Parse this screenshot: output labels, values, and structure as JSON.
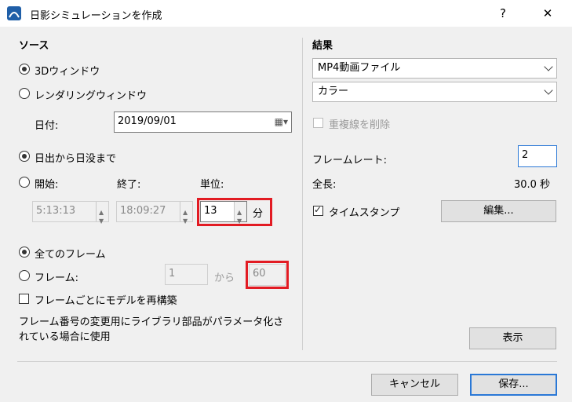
{
  "window": {
    "title": "日影シミュレーションを作成",
    "help": "?",
    "close": "✕"
  },
  "source": {
    "heading": "ソース",
    "opt_3d": "3Dウィンドウ",
    "opt_render": "レンダリングウィンドウ",
    "date_label": "日付:",
    "date_value": "2019/09/01",
    "opt_sun": "日出から日没まで",
    "opt_start": "開始:",
    "end_label": "終了:",
    "unit_label": "単位:",
    "start_value": "5:13:13",
    "end_value": "18:09:27",
    "unit_value": "13",
    "unit_suffix": "分",
    "opt_all_frames": "全てのフレーム",
    "opt_frames": "フレーム:",
    "frame_from": "1",
    "from_label": "から",
    "frame_to": "60",
    "rebuild_label": "フレームごとにモデルを再構築",
    "note": "フレーム番号の変更用にライブラリ部品がパラメータ化されている場合に使用"
  },
  "result": {
    "heading": "結果",
    "format": "MP4動画ファイル",
    "color": "カラー",
    "remove_dup": "重複線を削除",
    "frame_rate_label": "フレームレート:",
    "frame_rate_value": "2",
    "length_label": "全長:",
    "length_value": "30.0 秒",
    "timestamp_label": "タイムスタンプ",
    "edit_button": "編集...",
    "show_button": "表示"
  },
  "footer": {
    "cancel": "キャンセル",
    "save": "保存..."
  },
  "colors": {
    "highlight": "#e21b23",
    "focus": "#2a78d6"
  }
}
